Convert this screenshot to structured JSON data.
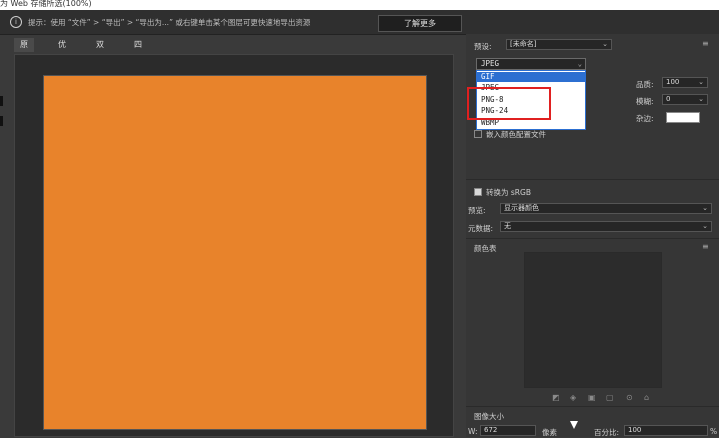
{
  "window": {
    "title": "为 Web 存储所选(100%)"
  },
  "infobar": {
    "tip": "提示：使用 “文件” > “导出” > “导出为...” 或右键单击某个图层可更快速地导出资源",
    "learn_more": "了解更多"
  },
  "tabs": [
    {
      "label": "原稿",
      "active": true
    },
    {
      "label": "优化",
      "active": false
    },
    {
      "label": "双联",
      "active": false
    },
    {
      "label": "四联",
      "active": false
    }
  ],
  "canvas": {
    "image_color": "#e8832b"
  },
  "settings": {
    "preset_label": "预设:",
    "preset_value": "[未命名]",
    "format_value": "JPEG",
    "format_options": [
      "GIF",
      "JPEG",
      "PNG-8",
      "PNG-24",
      "WBMP"
    ],
    "format_selected": "GIF",
    "quality_label": "品质:",
    "quality_value": "100",
    "blur_label": "模糊:",
    "blur_value": "0",
    "matte_label": "杂边:",
    "embed_profile_label": "嵌入颜色配置文件",
    "convert_srgb_label": "转换为 sRGB",
    "preview_label": "预览:",
    "preview_value": "显示器颜色",
    "metadata_label": "元数据:",
    "metadata_value": "无",
    "color_table_label": "颜色表",
    "image_size_label": "图像大小",
    "width_label": "W:",
    "width_value": "672",
    "width_unit": "像素",
    "percent_label": "百分比:",
    "percent_value": "100",
    "percent_unit": "%"
  }
}
